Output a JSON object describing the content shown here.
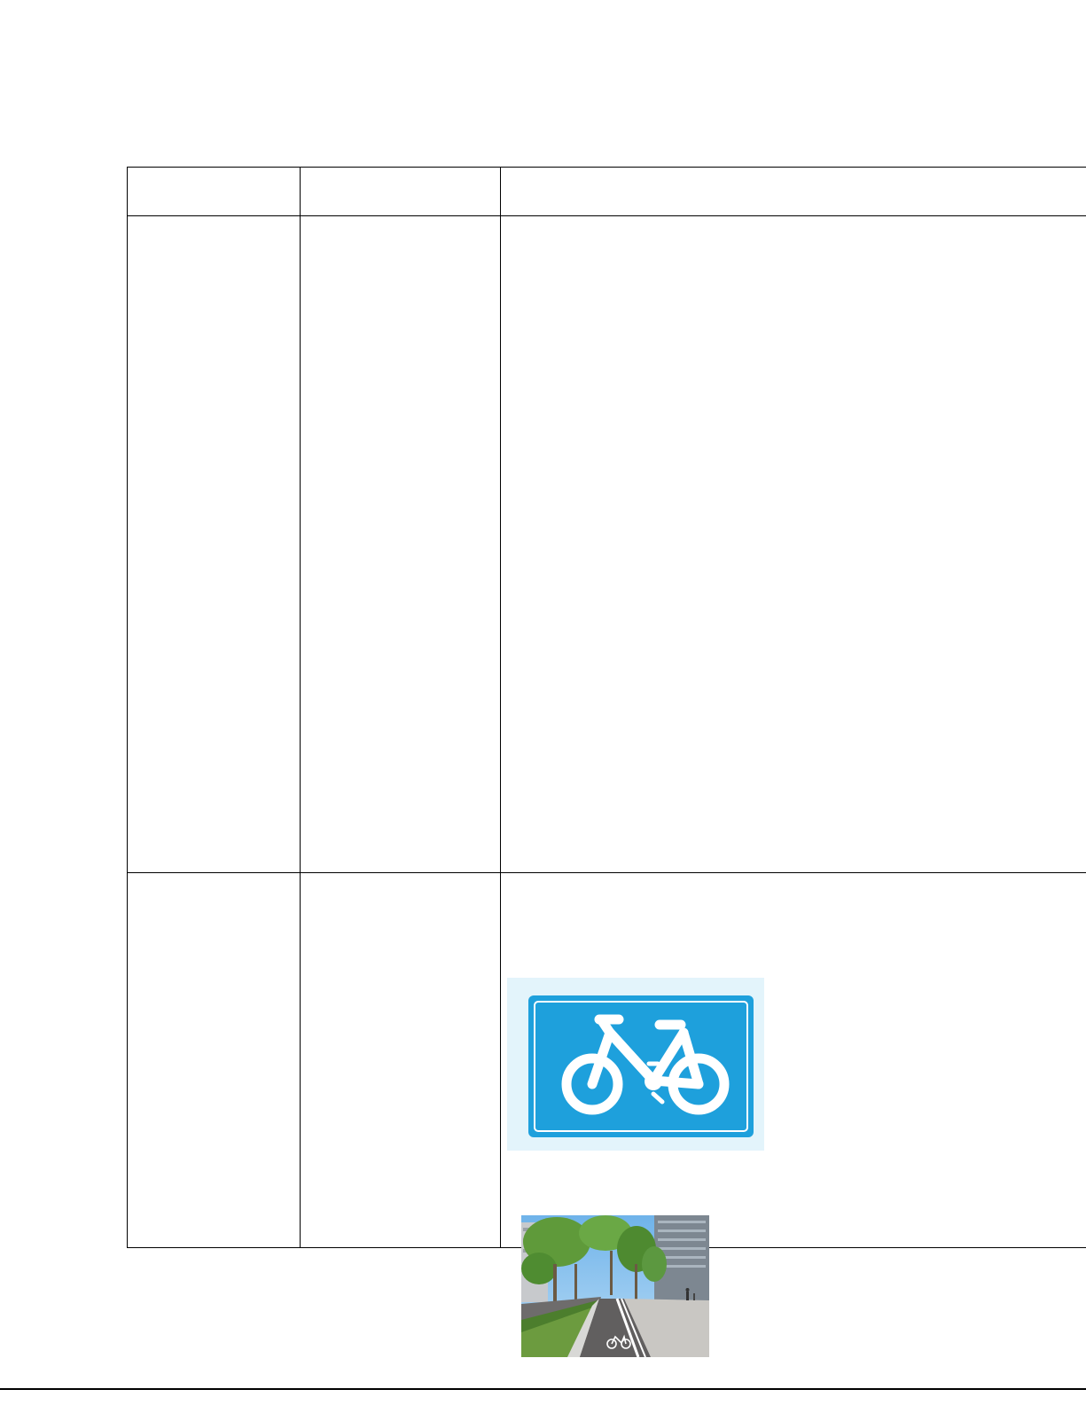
{
  "table": {
    "header": [
      "",
      "",
      ""
    ],
    "rows": [
      [
        "",
        "",
        ""
      ],
      [
        "",
        "",
        ""
      ]
    ]
  },
  "figures": {
    "sign": {
      "icon": "bicycle-icon",
      "panel_color": "#1ea0dc",
      "background_color": "#e3f4fb",
      "symbol_color": "#ffffff"
    },
    "photo": {
      "icon": "bicycle-lane-marking-icon",
      "sky_color": "#8ec3ee",
      "road_color": "#6e6c6c",
      "foliage_color": "#5f9a3a"
    }
  }
}
